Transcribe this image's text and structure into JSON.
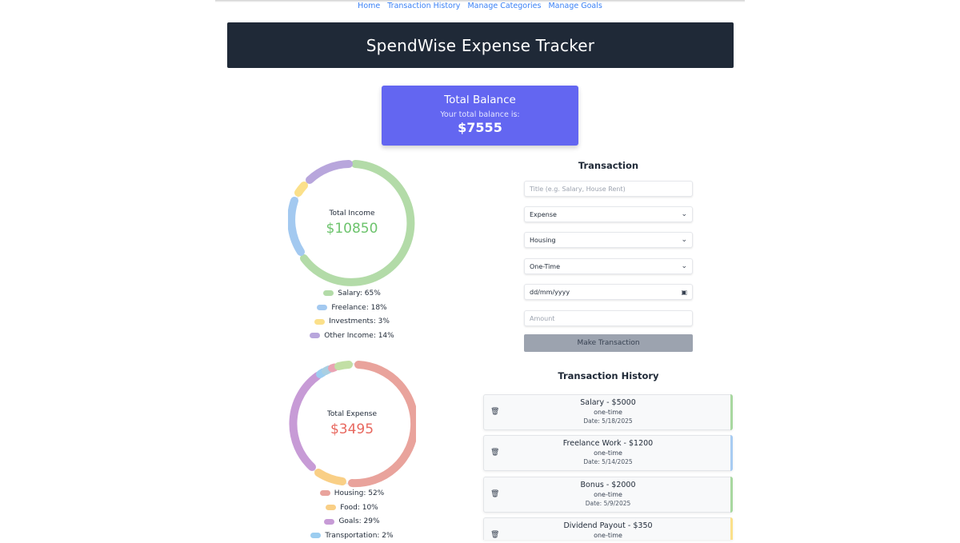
{
  "nav": {
    "items": [
      "Home",
      "Transaction History",
      "Manage Categories",
      "Manage Goals"
    ]
  },
  "header": {
    "title": "SpendWise Expense Tracker"
  },
  "balance": {
    "title": "Total Balance",
    "subtitle": "Your total balance is:",
    "amount": "$7555"
  },
  "income": {
    "label": "Total Income",
    "amount": "$10850",
    "amount_color": "#6cc36c",
    "legend": [
      {
        "text": "Salary: 65%",
        "color": "#b3dba8"
      },
      {
        "text": "Freelance: 18%",
        "color": "#a3c9f0"
      },
      {
        "text": "Investments: 3%",
        "color": "#fbe08a"
      },
      {
        "text": "Other Income: 14%",
        "color": "#b8a6dc"
      }
    ]
  },
  "expense": {
    "label": "Total Expense",
    "amount": "$3495",
    "amount_color": "#e8685f",
    "legend": [
      {
        "text": "Housing: 52%",
        "color": "#e9a39c"
      },
      {
        "text": "Food: 10%",
        "color": "#f9cf86"
      },
      {
        "text": "Goals: 29%",
        "color": "#c79bd6"
      },
      {
        "text": "Transportation: 2%",
        "color": "#9ccdf0"
      }
    ]
  },
  "form": {
    "title": "Transaction",
    "title_placeholder": "Title (e.g. Salary, House Rent)",
    "type": "Expense",
    "category": "Housing",
    "frequency": "One-Time",
    "date_placeholder": "dd/mm/yyyy",
    "amount_placeholder": "Amount",
    "submit_label": "Make Transaction"
  },
  "history": {
    "title": "Transaction History",
    "items": [
      {
        "title": "Salary - $5000",
        "frequency": "one-time",
        "date": "Date: 5/18/2025",
        "color": "#a8d8a0"
      },
      {
        "title": "Freelance Work - $1200",
        "frequency": "one-time",
        "date": "Date: 5/14/2025",
        "color": "#a8ccf2"
      },
      {
        "title": "Bonus - $2000",
        "frequency": "one-time",
        "date": "Date: 5/9/2025",
        "color": "#a8d8a0"
      },
      {
        "title": "Dividend Payout - $350",
        "frequency": "one-time",
        "date": "",
        "color": "#fbe08a"
      }
    ]
  }
}
